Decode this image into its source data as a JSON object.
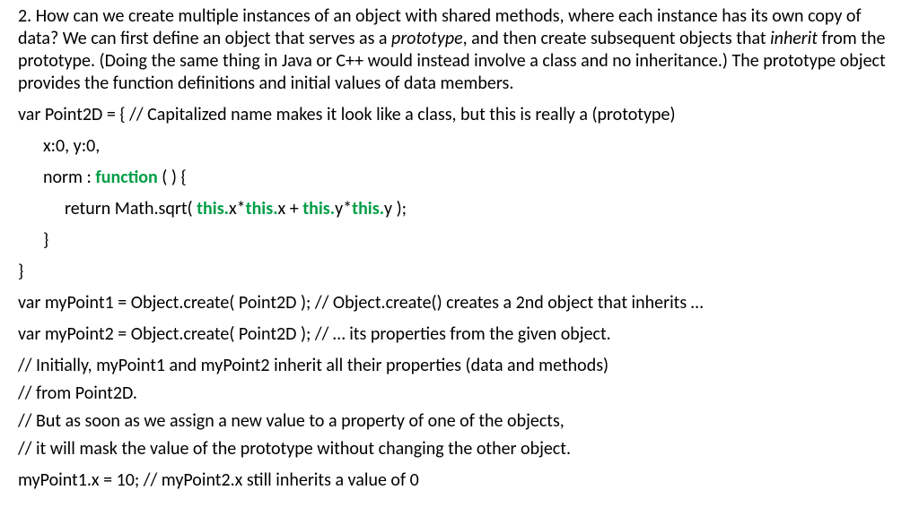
{
  "intro": {
    "q_num": "2. ",
    "q_p1": "How can we create multiple instances of an object with shared methods, where each instance has its own copy of data? We can first define an object that serves as a ",
    "q_i1": "prototype",
    "q_p2": ", and then create subsequent objects that ",
    "q_i2": "inherit",
    "q_p3": " from the prototype. (Doing the same thing in Java or C++ would instead involve a class and no inheritance.) The prototype object provides the function definitions and initial values of data members."
  },
  "code": {
    "l1": "var Point2D = { // Capitalized name makes it look like a class, but this is really a (prototype)",
    "l2": "x:0, y:0,",
    "l3a": "norm : ",
    "l3_kw": "function",
    "l3b": " ( ) {",
    "l4a": "return Math.sqrt( ",
    "l4_t1": "this.",
    "l4b": "x*",
    "l4_t2": "this.",
    "l4c": "x + ",
    "l4_t3": "this.",
    "l4d": "y*",
    "l4_t4": "this.",
    "l4e": "y );",
    "l5": "}",
    "l6": "}",
    "l7": "var myPoint1 = Object.create( Point2D ); // Object.create() creates a 2nd object that inherits …",
    "l8": "var myPoint2 = Object.create( Point2D ); // … its properties from the given object.",
    "l9": "// Initially, myPoint1 and myPoint2 inherit all their properties (data and methods)",
    "l10": "// from Point2D.",
    "l11": "// But as soon as we assign a new value to a property of one of the objects,",
    "l12": "// it will mask the value of the prototype without changing the other object.",
    "l13": "myPoint1.x = 10;   // myPoint2.x  still inherits a value of  0"
  }
}
